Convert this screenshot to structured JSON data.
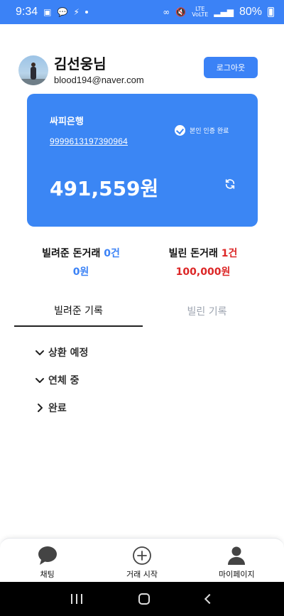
{
  "status_bar": {
    "time": "9:34",
    "battery_pct": "80%",
    "network_top": "LTE",
    "network_bottom": "VoLTE"
  },
  "profile": {
    "name": "김선웅님",
    "email": "blood194@naver.com",
    "logout_label": "로그아웃"
  },
  "account": {
    "bank_name": "싸피은행",
    "verified_label": "본인 인증 완료",
    "account_number": "9999613197390964",
    "balance": "491,559원"
  },
  "stats": {
    "lent": {
      "title": "빌려준 돈거래 ",
      "count": "0건",
      "amount": "0원"
    },
    "borrowed": {
      "title": "빌린 돈거래 ",
      "count": "1건",
      "amount": "100,000원"
    }
  },
  "tabs": [
    {
      "label": "빌려준 기록",
      "active": true
    },
    {
      "label": "빌린 기록",
      "active": false
    }
  ],
  "sections": [
    {
      "label": "상환 예정",
      "expanded": true
    },
    {
      "label": "연체 중",
      "expanded": true
    },
    {
      "label": "완료",
      "expanded": false
    }
  ],
  "bottom_nav": [
    {
      "label": "채팅",
      "icon": "chat-bubble-icon"
    },
    {
      "label": "거래 시작",
      "icon": "plus-circle-icon"
    },
    {
      "label": "마이페이지",
      "icon": "person-icon"
    }
  ],
  "colors": {
    "primary": "#3b82f6",
    "danger": "#dc2626",
    "inactive_tab": "#9ca3af"
  }
}
